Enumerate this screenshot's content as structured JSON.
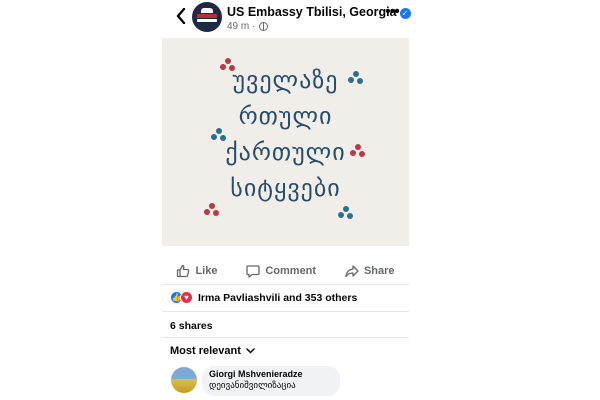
{
  "header": {
    "page_name": "US Embassy Tbilisi, Georgia",
    "verified_mark": "✓",
    "time_ago": "49 m ·",
    "back_icon": "chevron-left-icon",
    "more_icon": "more-horizontal-icon",
    "more_label": "•••"
  },
  "post": {
    "poem_lines": [
      "უველაზე",
      "რთული",
      "ქართული",
      "სიტყვები"
    ],
    "accent_colors": {
      "text": "#264e6a",
      "red": "#b83a44",
      "teal": "#2b6f8e",
      "background": "#f1ede9"
    }
  },
  "actions": {
    "like_label": "Like",
    "comment_label": "Comment",
    "share_label": "Share"
  },
  "reactions": {
    "summary": "Irma Pavliashvili and 353 others",
    "like_glyph": "👍",
    "love_glyph": "♥"
  },
  "shares": {
    "label": "6 shares"
  },
  "comments": {
    "sort_label": "Most relevant",
    "items": [
      {
        "author": "Giorgi Mshvenieradze",
        "text": "დეივანიშვილიზაცია"
      }
    ]
  }
}
